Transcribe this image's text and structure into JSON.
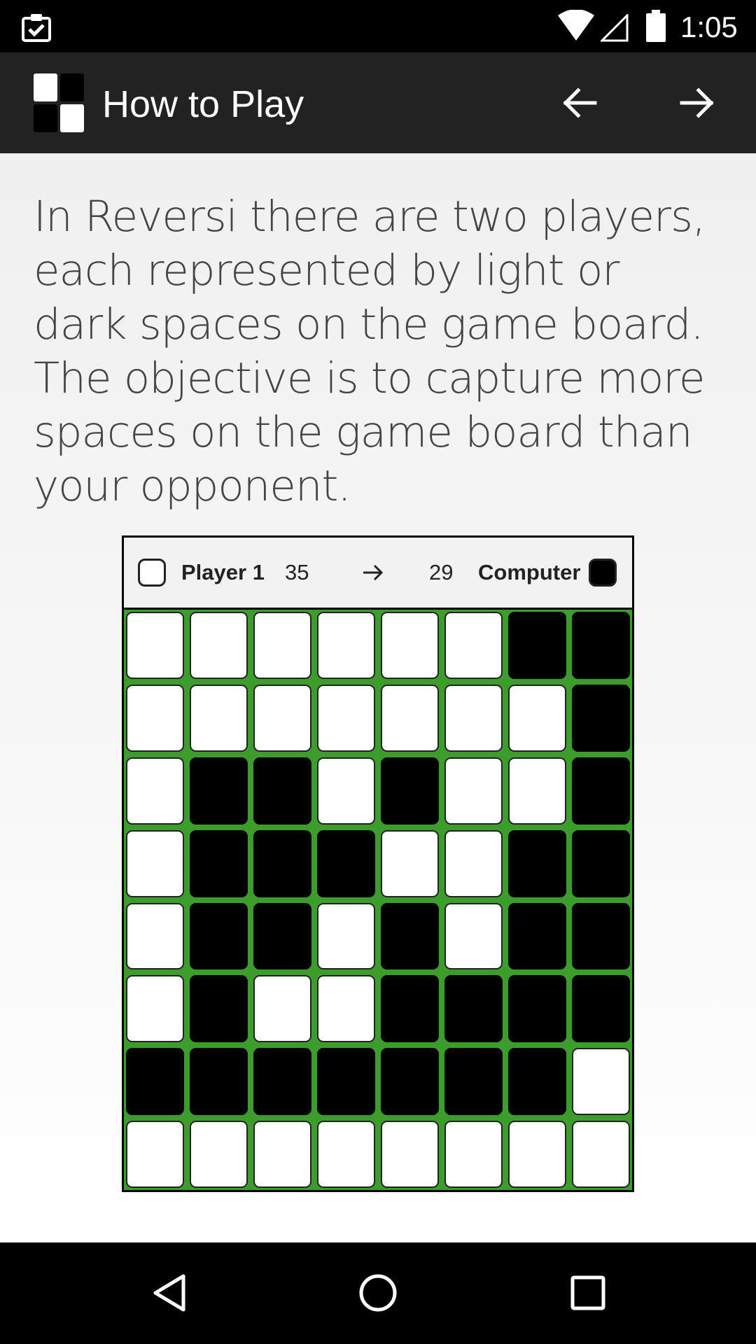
{
  "status_bar": {
    "time": "1:05"
  },
  "action_bar": {
    "title": "How to Play"
  },
  "content": {
    "intro": "In Reversi there are two players, each represented by light or dark spaces on the game board. The objective is to capture more spaces on the game board than your opponent."
  },
  "scoreboard": {
    "player_name": "Player 1",
    "player_score": "35",
    "computer_name": "Computer",
    "computer_score": "29"
  },
  "board": [
    [
      "w",
      "w",
      "w",
      "w",
      "w",
      "w",
      "b",
      "b"
    ],
    [
      "w",
      "w",
      "w",
      "w",
      "w",
      "w",
      "w",
      "b"
    ],
    [
      "w",
      "b",
      "b",
      "w",
      "b",
      "w",
      "w",
      "b"
    ],
    [
      "w",
      "b",
      "b",
      "b",
      "w",
      "w",
      "b",
      "b"
    ],
    [
      "w",
      "b",
      "b",
      "w",
      "b",
      "w",
      "b",
      "b"
    ],
    [
      "w",
      "b",
      "w",
      "w",
      "b",
      "b",
      "b",
      "b"
    ],
    [
      "b",
      "b",
      "b",
      "b",
      "b",
      "b",
      "b",
      "w"
    ],
    [
      "w",
      "w",
      "w",
      "w",
      "w",
      "w",
      "w",
      "w"
    ]
  ],
  "colors": {
    "board_green": "#3c9c2c",
    "action_bar": "#222222"
  }
}
